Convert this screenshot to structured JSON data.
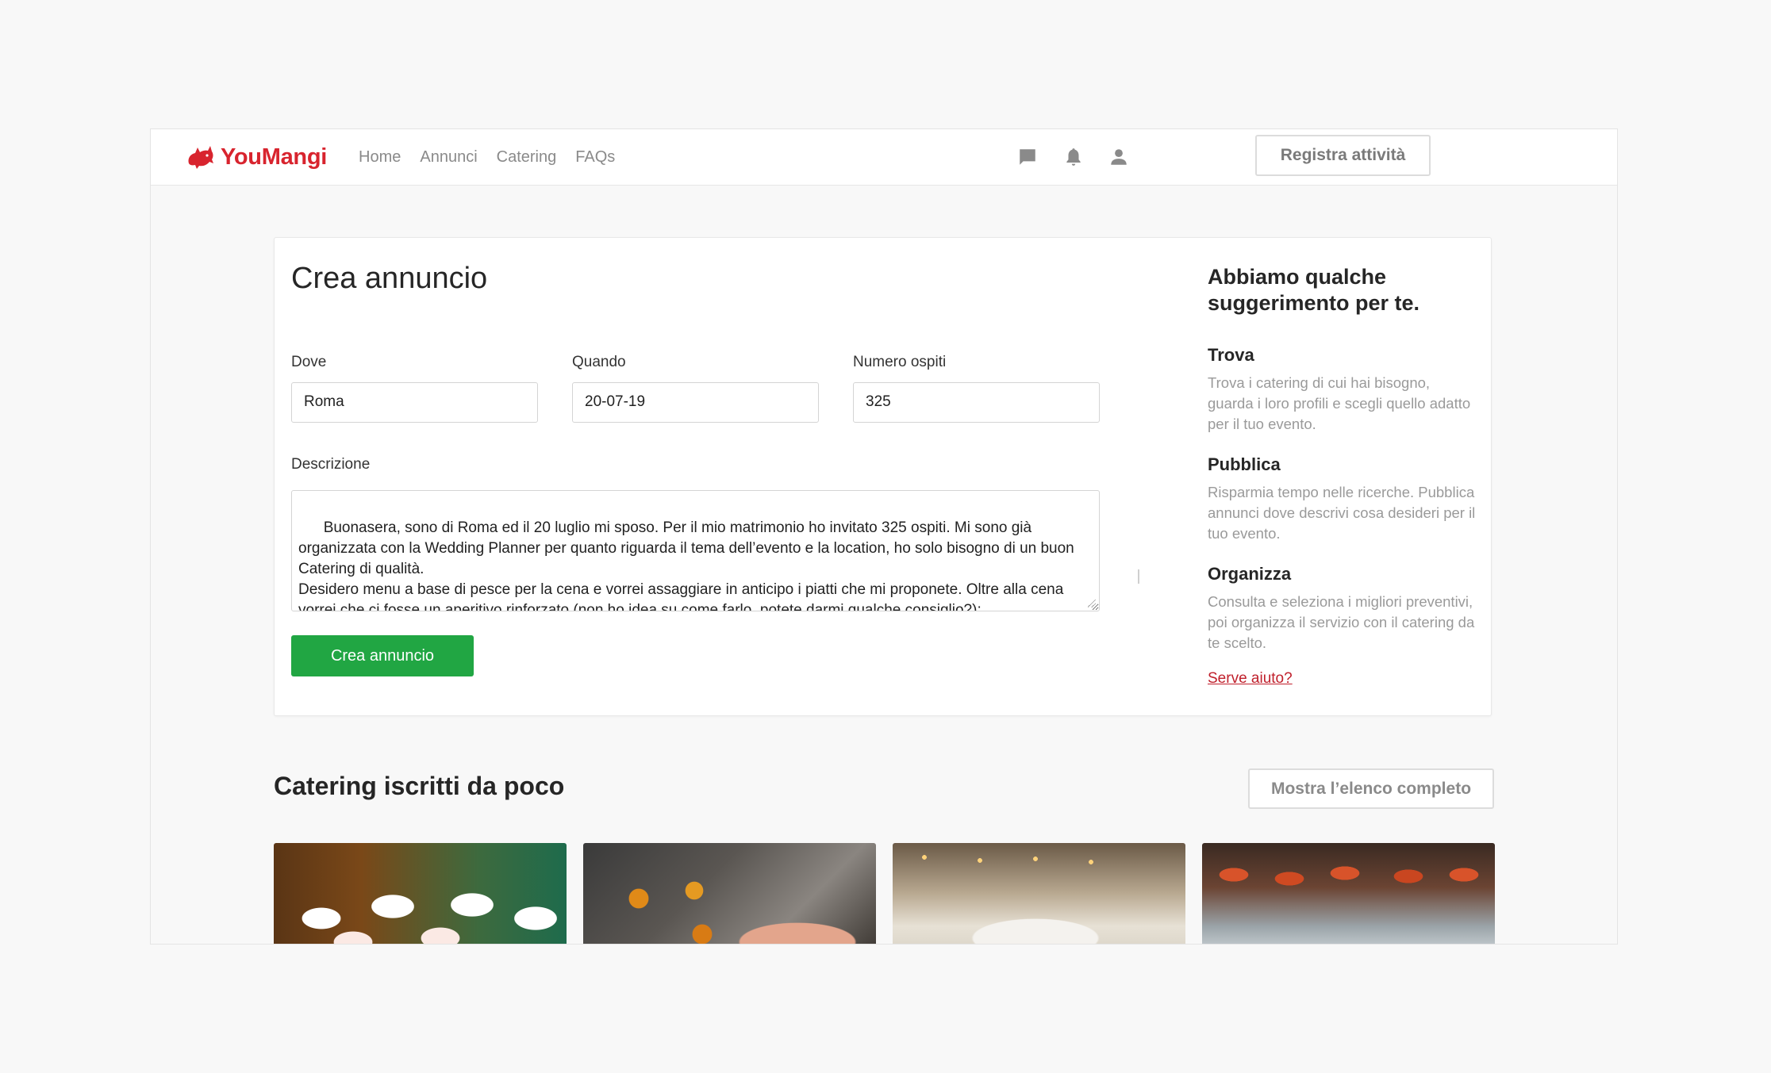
{
  "brand": {
    "name": "YouMangi",
    "color": "#d8242e",
    "logo_icon": "rhino-icon"
  },
  "nav": {
    "items": [
      {
        "label": "Home"
      },
      {
        "label": "Annunci"
      },
      {
        "label": "Catering"
      },
      {
        "label": "FAQs"
      }
    ]
  },
  "topbar": {
    "register_label": "Registra attività",
    "icons": [
      "chat-icon",
      "bell-icon",
      "user-icon"
    ]
  },
  "form": {
    "title": "Crea annuncio",
    "where": {
      "label": "Dove",
      "value": "Roma"
    },
    "when": {
      "label": "Quando",
      "value": "20-07-19"
    },
    "guests": {
      "label": "Numero ospiti",
      "value": "325"
    },
    "description": {
      "label": "Descrizione",
      "value": "Buonasera, sono di Roma ed il 20 luglio mi sposo. Per il mio matrimonio ho invitato 325 ospiti. Mi sono già organizzata con la Wedding Planner per quanto riguarda il tema dell’evento e la location, ho solo bisogno di un buon Catering di qualità.\nDesidero menu a base di pesce per la cena e vorrei assaggiare in anticipo i piatti che mi proponete. Oltre alla cena vorrei che ci fosse un aperitivo rinforzato (non ho idea su come farlo, potete darmi qualche consiglio?);"
    },
    "submit_label": "Crea annuncio",
    "submit_color": "#21a643"
  },
  "suggestions": {
    "title": "Abbiamo qualche suggerimento per te.",
    "items": [
      {
        "heading": "Trova",
        "text": "Trova i catering di cui hai bisogno, guarda i loro profili e scegli quello adatto per il tuo evento."
      },
      {
        "heading": "Pubblica",
        "text": "Risparmia tempo nelle ricerche. Pubblica annunci dove descrivi cosa desideri per il tuo evento."
      },
      {
        "heading": "Organizza",
        "text": "Consulta e seleziona i migliori preventivi, poi organizza il servizio con il catering da te scelto."
      }
    ],
    "help_link": "Serve aiuto?"
  },
  "recent": {
    "title": "Catering iscritti da poco",
    "show_all_label": "Mostra l’elenco completo"
  }
}
